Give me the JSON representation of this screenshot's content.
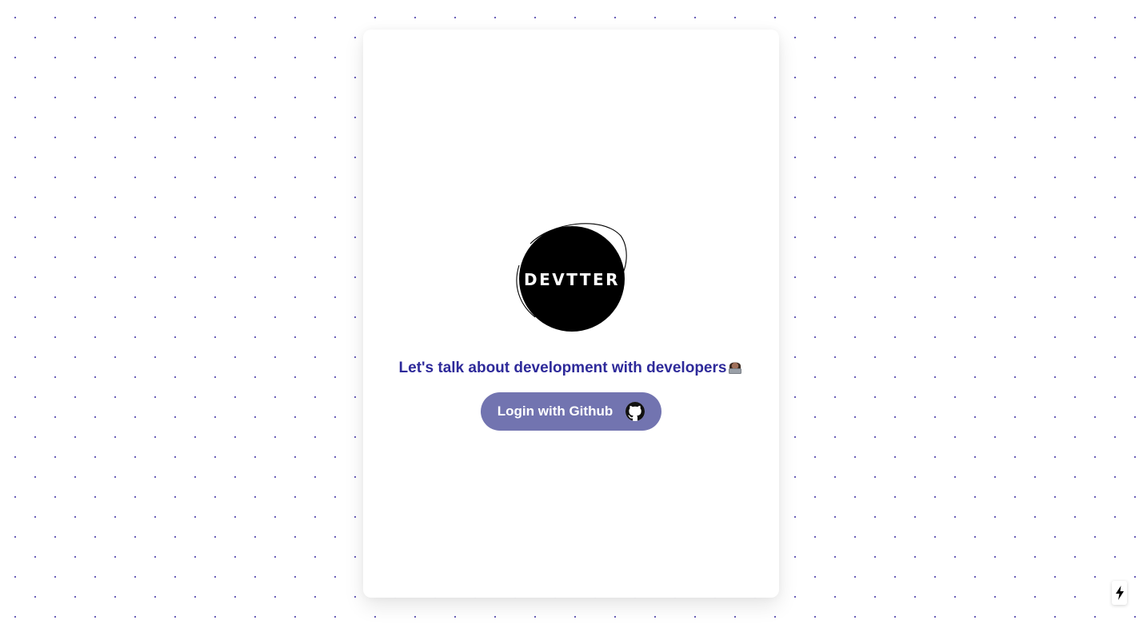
{
  "logo": {
    "text": "DEVTTER"
  },
  "tagline": {
    "text": "Let's talk about development with developers",
    "emoji": "👩🏽‍💻"
  },
  "login_button": {
    "label": "Login with Github",
    "icon": "github-icon"
  },
  "dev_indicator": {
    "icon": "lightning-bolt-icon"
  },
  "colors": {
    "background": "#ffffff",
    "dots": "#5b4fb0",
    "tagline": "#2e2a9a",
    "button": "#7274b0",
    "logo": "#000000"
  }
}
